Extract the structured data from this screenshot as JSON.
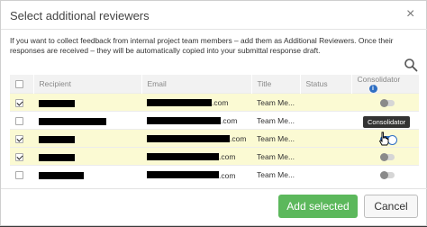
{
  "dialog": {
    "title": "Select additional reviewers",
    "close_glyph": "×",
    "description": "If you want to collect feedback from internal project team members – add them as Additional Reviewers. Once their responses are received – they will be automatically copied into your submittal response draft."
  },
  "table": {
    "columns": [
      "Recipient",
      "Email",
      "Title",
      "Status",
      "Consolidator"
    ],
    "rows": [
      {
        "selected": true,
        "email_suffix": ".com",
        "title": "Team Me...",
        "status": "",
        "consolidator": false
      },
      {
        "selected": false,
        "email_suffix": ".com",
        "title": "Team Me...",
        "status": "",
        "consolidator": false
      },
      {
        "selected": true,
        "email_suffix": ".com",
        "title": "Team Me...",
        "status": "",
        "consolidator": true
      },
      {
        "selected": true,
        "email_suffix": ".com",
        "title": "Team Me...",
        "status": "",
        "consolidator": false
      },
      {
        "selected": false,
        "email_suffix": ".com",
        "title": "Team Me...",
        "status": "",
        "consolidator": false
      }
    ]
  },
  "tooltip": "Consolidator",
  "icons": {
    "search": "search-icon",
    "info": "info-icon",
    "close": "close-icon"
  },
  "buttons": {
    "add_selected": "Add selected",
    "cancel": "Cancel"
  },
  "colors": {
    "primary_button": "#5cb85c",
    "toggle_on": "#2f6fc3",
    "selected_row": "#fbfad3"
  }
}
